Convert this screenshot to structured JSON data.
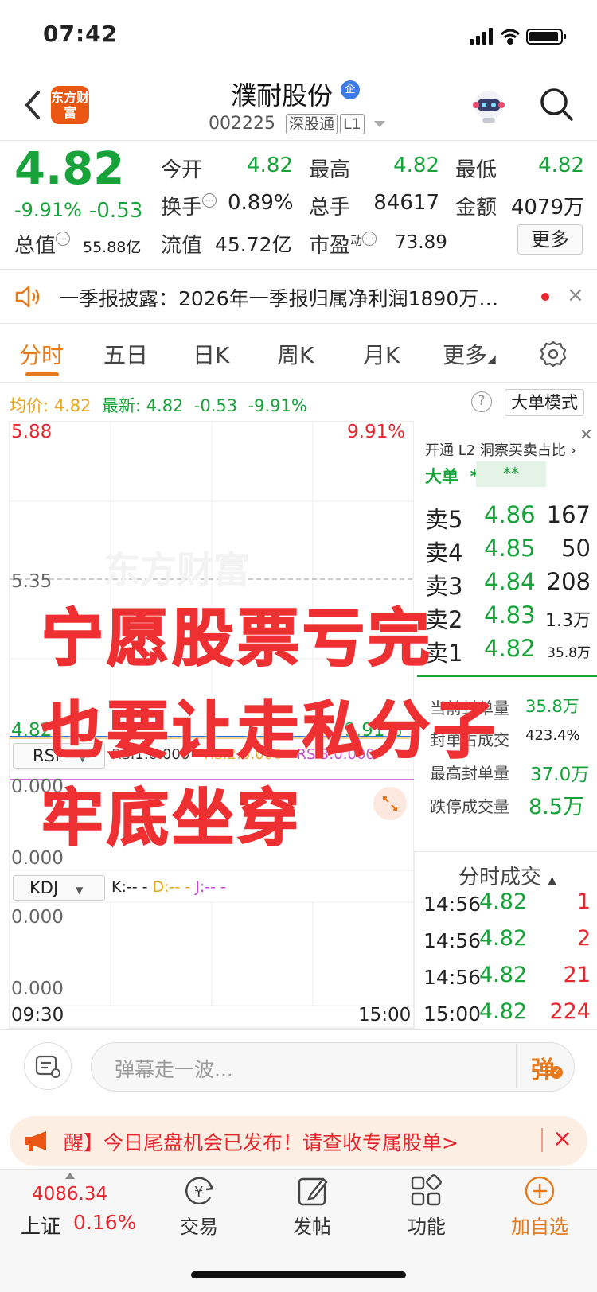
{
  "status_bar": {
    "time": "07:42"
  },
  "header": {
    "logo_text": "东方财富",
    "stock_name": "濮耐股份",
    "name_badge": "企",
    "stock_code": "002225",
    "tag_exchange": "深股通",
    "tag_level": "L1"
  },
  "quote": {
    "price": "4.82",
    "change_pct": "-9.91%",
    "change": "-0.53",
    "fields": [
      {
        "label": "今开",
        "value": "4.82"
      },
      {
        "label": "最高",
        "value": "4.82"
      },
      {
        "label": "最低",
        "value": "4.82"
      },
      {
        "label": "换手",
        "value": "0.89%"
      },
      {
        "label": "总手",
        "value": "84617"
      },
      {
        "label": "金额",
        "value": "4079万"
      },
      {
        "label": "总值",
        "value": "55.88亿"
      },
      {
        "label": "流值",
        "value": "45.72亿"
      },
      {
        "label": "市盈",
        "label_sup": "动",
        "value": "73.89"
      }
    ],
    "more_label": "更多"
  },
  "notice": {
    "text": "一季报披露：2026年一季报归属净利润1890万…",
    "close": "×"
  },
  "tabs": [
    "分时",
    "五日",
    "日K",
    "周K",
    "月K",
    "更多"
  ],
  "info_line": {
    "avg_label": "均价:",
    "avg_value": "4.82",
    "latest_label": "最新:",
    "latest_value": "4.82",
    "change": "-0.53",
    "change_pct": "-9.91%",
    "help": "?",
    "big_order_mode": "大单模式"
  },
  "chart": {
    "price_top": "5.88",
    "pct_top": "9.91%",
    "price_mid": "5.35",
    "price_bottom": "4.82",
    "pct_bottom": "-9.91%",
    "watermark": "东方财富",
    "rsi_select": "RSI",
    "rsi1": "RSI1:0.000",
    "rsi2": "RSI2:0.000",
    "rsi3": "RSI3:0.000",
    "rsi_top": "0.000",
    "rsi_bottom": "0.000",
    "kdj_select": "KDJ",
    "kdj_k": "K:--",
    "kdj_d": "D:--",
    "kdj_j": "J:--",
    "kdj_top": "0.000",
    "kdj_bottom": "0.000",
    "time_start": "09:30",
    "time_end": "15:00"
  },
  "right_panel": {
    "title": "开通 L2 洞察买卖占比",
    "dadan_label": "大单",
    "dadan_v1": "**",
    "dadan_v2": "**",
    "asks": [
      {
        "label": "卖5",
        "price": "4.86",
        "vol": "167"
      },
      {
        "label": "卖4",
        "price": "4.85",
        "vol": "50"
      },
      {
        "label": "卖3",
        "price": "4.84",
        "vol": "208"
      },
      {
        "label": "卖2",
        "price": "4.83",
        "vol": "1.3万"
      },
      {
        "label": "卖1",
        "price": "4.82",
        "vol": "35.8万"
      }
    ],
    "seal_label": "当前封单量",
    "seal_value": "35.8万",
    "seal_ratio_label": "封单占成交",
    "seal_ratio_value": "423.4%",
    "max_seal_label": "最高封单量",
    "max_seal_value": "37.0万",
    "limit_vol_label": "跌停成交量",
    "limit_vol_value": "8.5万",
    "trades_title": "分时成交",
    "trades": [
      {
        "time": "14:56",
        "price": "4.82",
        "vol": "1"
      },
      {
        "time": "14:56",
        "price": "4.82",
        "vol": "2"
      },
      {
        "time": "14:56",
        "price": "4.82",
        "vol": "21"
      },
      {
        "time": "15:00",
        "price": "4.82",
        "vol": "224"
      }
    ]
  },
  "overlay": {
    "line1": "宁愿股票亏完",
    "line2": "也要让走私分子",
    "line3": "牢底坐穿"
  },
  "comment": {
    "placeholder": "弹幕走一波...",
    "danmu_label": "弹"
  },
  "promo": {
    "text": "醒】今日尾盘机会已发布！请查收专属股单>",
    "close": "×"
  },
  "bottom_nav": {
    "index_value": "4086.34",
    "index_name": "上证",
    "index_pct": "0.16%",
    "items": [
      {
        "label": "交易"
      },
      {
        "label": "发帖"
      },
      {
        "label": "功能"
      },
      {
        "label": "加自选"
      }
    ]
  },
  "colors": {
    "up": "#e8262d",
    "down": "#17a339",
    "accent": "#e77a1c"
  }
}
